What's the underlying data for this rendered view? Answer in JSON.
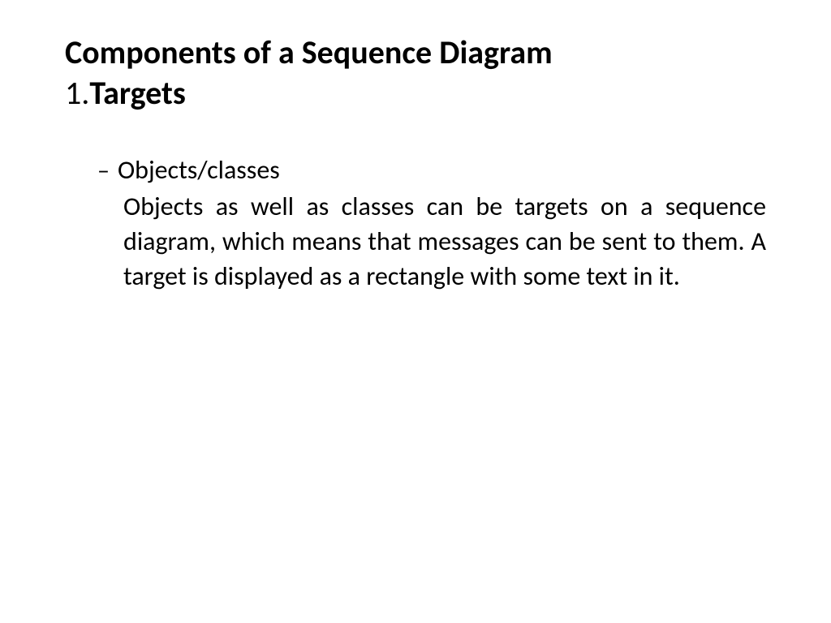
{
  "slide": {
    "title": "Components of a Sequence Diagram",
    "subtitle_number": "1.",
    "subtitle_text": "Targets",
    "bullet_label": "Objects/classes",
    "bullet_dash": "–",
    "body": "Objects as well as classes can be targets on a sequence diagram, which means that messages can be sent to them. A target is displayed as a rectangle with some text in it."
  }
}
